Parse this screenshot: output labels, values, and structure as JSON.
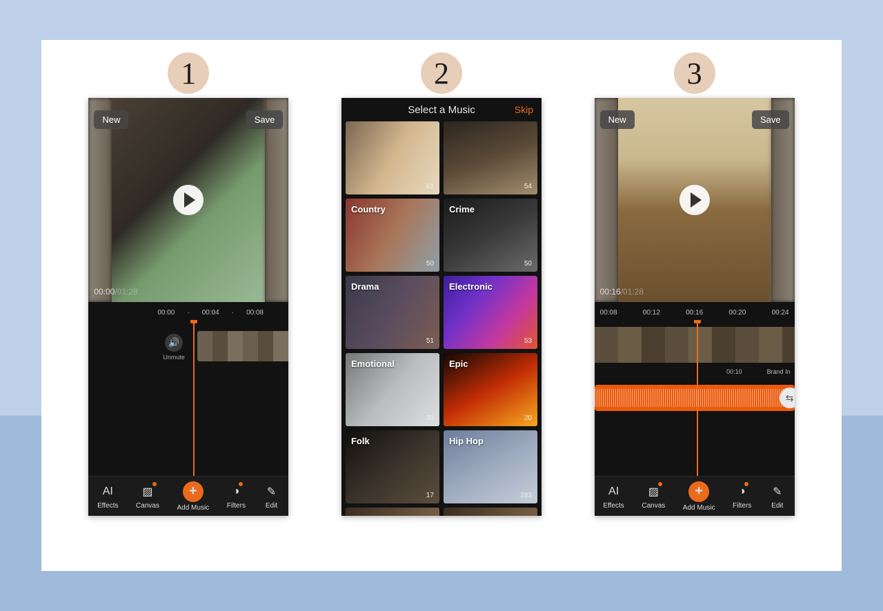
{
  "badges": {
    "one": "1",
    "two": "2",
    "three": "3"
  },
  "editor": {
    "newLabel": "New",
    "saveLabel": "Save",
    "toolbar": {
      "effects": "Effects",
      "canvas": "Canvas",
      "addMusic": "Add Music",
      "filters": "Filters",
      "edit": "Edit"
    }
  },
  "screen1": {
    "time": {
      "current": "00:00",
      "duration": "01:28"
    },
    "ruler": [
      "00:00",
      "·",
      "00:04",
      "·",
      "00:08"
    ],
    "unmute": "Unmute"
  },
  "screen3": {
    "time": {
      "current": "00:16",
      "duration": "01:28"
    },
    "ruler": [
      "00:08",
      "00:12",
      "00:16",
      "00:20",
      "00:24"
    ],
    "trackTime": "00:10",
    "trackLabel": "Brand In"
  },
  "music": {
    "title": "Select a Music",
    "skip": "Skip",
    "tiles": [
      {
        "label": "",
        "count": "61",
        "cls": "bird"
      },
      {
        "label": "",
        "count": "54",
        "cls": "strings"
      },
      {
        "label": "Country",
        "count": "50",
        "cls": "country"
      },
      {
        "label": "Crime",
        "count": "50",
        "cls": "crime"
      },
      {
        "label": "Drama",
        "count": "51",
        "cls": "drama"
      },
      {
        "label": "Electronic",
        "count": "53",
        "cls": "electronic"
      },
      {
        "label": "Emotional",
        "count": "39",
        "cls": "emotional"
      },
      {
        "label": "Epic",
        "count": "20",
        "cls": "epic"
      },
      {
        "label": "Folk",
        "count": "17",
        "cls": "folk"
      },
      {
        "label": "Hip Hop",
        "count": "283",
        "cls": "hiphop"
      }
    ]
  }
}
